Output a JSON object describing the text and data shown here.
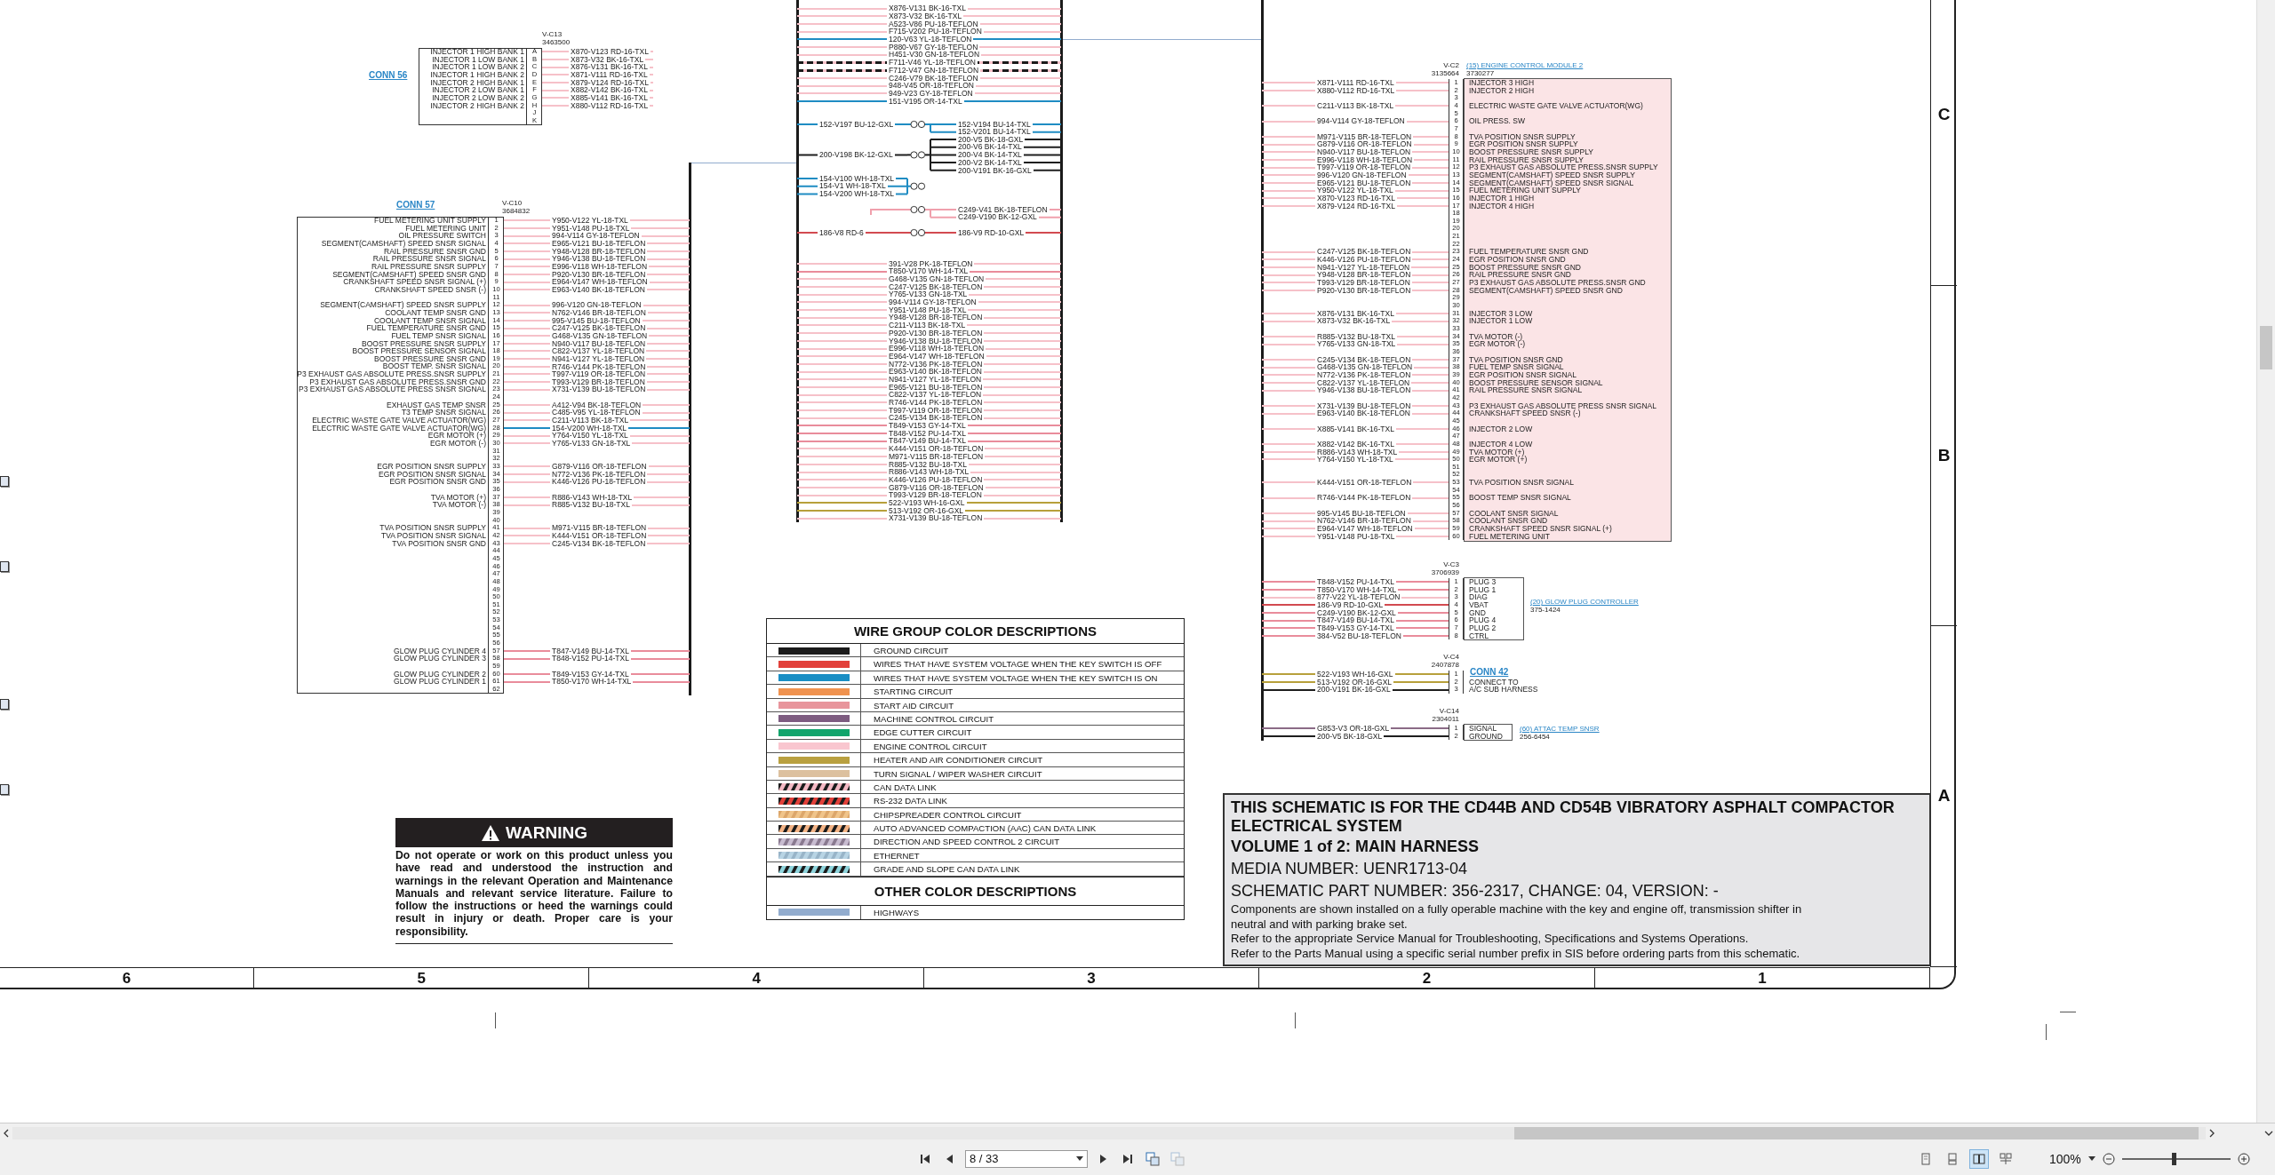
{
  "conn_56": {
    "title": "CONN 56",
    "header": "V-C13",
    "part": "3463500",
    "pins": [
      {
        "pin": "A",
        "label": "INJECTOR 1 HIGH BANK 1",
        "wire": "X870-V123 RD-16-TXL",
        "color": "#f6c1c9"
      },
      {
        "pin": "B",
        "label": "INJECTOR 1 LOW BANK 1",
        "wire": "X873-V32 BK-16-TXL",
        "color": "#f6c1c9"
      },
      {
        "pin": "C",
        "label": "INJECTOR 1 LOW BANK 2",
        "wire": "X876-V131 BK-16-TXL",
        "color": "#f6c1c9"
      },
      {
        "pin": "D",
        "label": "INJECTOR 1 HIGH BANK 2",
        "wire": "X871-V111 RD-16-TXL",
        "color": "#f6c1c9"
      },
      {
        "pin": "E",
        "label": "INJECTOR 2 HIGH BANK 1",
        "wire": "X879-V124 RD-16-TXL",
        "color": "#f6c1c9"
      },
      {
        "pin": "F",
        "label": "INJECTOR 2 LOW BANK 1",
        "wire": "X882-V142 BK-16-TXL",
        "color": "#f6c1c9"
      },
      {
        "pin": "G",
        "label": "INJECTOR 2 LOW BANK 2",
        "wire": "X885-V141 BK-16-TXL",
        "color": "#f6c1c9"
      },
      {
        "pin": "H",
        "label": "INJECTOR 2 HIGH BANK 2",
        "wire": "X880-V112 RD-16-TXL",
        "color": "#f6c1c9"
      },
      {
        "pin": "J"
      },
      {
        "pin": "K"
      }
    ]
  },
  "conn_57": {
    "title": "CONN 57",
    "header": "V-C10",
    "part": "3684832",
    "pins": [
      {
        "pin": "1",
        "label": "FUEL METERING UNIT SUPPLY",
        "wire": "Y950-V122 YL-18-TXL",
        "color": "#f6c1c9"
      },
      {
        "pin": "2",
        "label": "FUEL METERING UNIT",
        "wire": "Y951-V148 PU-18-TXL",
        "color": "#f6c1c9"
      },
      {
        "pin": "3",
        "label": "OIL PRESSURE SWITCH",
        "wire": "994-V114 GY-18-TEFLON",
        "color": "#f6c1c9"
      },
      {
        "pin": "4",
        "label": "SEGMENT(CAMSHAFT) SPEED SNSR SIGNAL",
        "wire": "E965-V121 BU-18-TEFLON",
        "color": "#f6c1c9"
      },
      {
        "pin": "5",
        "label": "RAIL PRESSURE SNSR GND",
        "wire": "Y948-V128 BR-18-TEFLON",
        "color": "#f6c1c9"
      },
      {
        "pin": "6",
        "label": "RAIL PRESSURE SNSR SIGNAL",
        "wire": "Y946-V138 BU-18-TEFLON",
        "color": "#f6c1c9"
      },
      {
        "pin": "7",
        "label": "RAIL PRESSURE SNSR SUPPLY",
        "wire": "E996-V118 WH-18-TEFLON",
        "color": "#f6c1c9"
      },
      {
        "pin": "8",
        "label": "SEGMENT(CAMSHAFT) SPEED SNSR GND",
        "wire": "P920-V130 BR-18-TEFLON",
        "color": "#f6c1c9"
      },
      {
        "pin": "9",
        "label": "CRANKSHAFT SPEED SNSR SIGNAL (+)",
        "wire": "E964-V147 WH-18-TEFLON",
        "color": "#f6c1c9"
      },
      {
        "pin": "10",
        "label": "CRANKSHAFT SPEED SNSR (-)",
        "wire": "E963-V140 BK-18-TEFLON",
        "color": "#f6c1c9"
      },
      {
        "pin": "11"
      },
      {
        "pin": "12",
        "label": "SEGMENT(CAMSHAFT) SPEED SNSR SUPPLY",
        "wire": "996-V120 GN-18-TEFLON",
        "color": "#f6c1c9"
      },
      {
        "pin": "13",
        "label": "COOLANT TEMP SNSR GND",
        "wire": "N762-V146 BR-18-TEFLON",
        "color": "#f6c1c9"
      },
      {
        "pin": "14",
        "label": "COOLANT TEMP SNSR SIGNAL",
        "wire": "995-V145 BU-18-TEFLON",
        "color": "#f6c1c9"
      },
      {
        "pin": "15",
        "label": "FUEL TEMPERATURE SNSR GND",
        "wire": "C247-V125 BK-18-TEFLON",
        "color": "#f6c1c9"
      },
      {
        "pin": "16",
        "label": "FUEL TEMP SNSR SIGNAL",
        "wire": "G468-V135 GN-18-TEFLON",
        "color": "#f6c1c9"
      },
      {
        "pin": "17",
        "label": "BOOST PRESSURE SNSR SUPPLY",
        "wire": "N940-V117 BU-18-TEFLON",
        "color": "#f6c1c9"
      },
      {
        "pin": "18",
        "label": "BOOST PRESSURE SENSOR SIGNAL",
        "wire": "C822-V137 YL-18-TEFLON",
        "color": "#f6c1c9"
      },
      {
        "pin": "19",
        "label": "BOOST PRESSURE SNSR GND",
        "wire": "N941-V127 YL-18-TEFLON",
        "color": "#f6c1c9"
      },
      {
        "pin": "20",
        "label": "BOOST TEMP. SNSR SIGNAL",
        "wire": "R746-V144 PK-18-TEFLON",
        "color": "#f6c1c9"
      },
      {
        "pin": "21",
        "label": "P3 EXHAUST GAS ABSOLUTE PRESS.SNSR SUPPLY",
        "wire": "T997-V119 OR-18-TEFLON",
        "color": "#f6c1c9"
      },
      {
        "pin": "22",
        "label": "P3 EXHAUST GAS ABSOLUTE PRESS.SNSR GND",
        "wire": "T993-V129 BR-18-TEFLON",
        "color": "#f6c1c9"
      },
      {
        "pin": "23",
        "label": "P3 EXHAUST GAS ABSOLUTE PRESS SNSR SIGNAL",
        "wire": "X731-V139 BU-18-TEFLON",
        "color": "#f6c1c9"
      },
      {
        "pin": "24"
      },
      {
        "pin": "25",
        "label": "EXHAUST GAS TEMP SNSR",
        "wire": "A412-V94 BK-18-TEFLON",
        "color": "#f6c1c9"
      },
      {
        "pin": "26",
        "label": "T3 TEMP SNSR SIGNAL",
        "wire": "C485-V95 YL-18-TEFLON",
        "color": "#f6c1c9"
      },
      {
        "pin": "27",
        "label": "ELECTRIC WASTE GATE VALVE ACTUATOR(WG)",
        "wire": "C211-V113 BK-18-TXL",
        "color": "#f6c1c9"
      },
      {
        "pin": "28",
        "label": "ELECTRIC WASTE GATE VALVE ACTUATOR(WG)",
        "wire": "154-V200 WH-18-TXL",
        "color": "#1f8cc3"
      },
      {
        "pin": "29",
        "label": "EGR MOTOR (+)",
        "wire": "Y764-V150 YL-18-TXL",
        "color": "#f6c1c9"
      },
      {
        "pin": "30",
        "label": "EGR MOTOR (-)",
        "wire": "Y765-V133 GN-18-TXL",
        "color": "#f6c1c9"
      },
      {
        "pin": "31"
      },
      {
        "pin": "32"
      },
      {
        "pin": "33",
        "label": "EGR POSITION SNSR SUPPLY",
        "wire": "G879-V116 OR-18-TEFLON",
        "color": "#f6c1c9"
      },
      {
        "pin": "34",
        "label": "EGR POSITION SNSR SIGNAL",
        "wire": "N772-V136 PK-18-TEFLON",
        "color": "#f6c1c9"
      },
      {
        "pin": "35",
        "label": "EGR POSITION SNSR GND",
        "wire": "K446-V126 PU-18-TEFLON",
        "color": "#f6c1c9"
      },
      {
        "pin": "36"
      },
      {
        "pin": "37",
        "label": "TVA MOTOR (+)",
        "wire": "R886-V143 WH-18-TXL",
        "color": "#f6c1c9"
      },
      {
        "pin": "38",
        "label": "TVA MOTOR (-)",
        "wire": "R885-V132 BU-18-TXL",
        "color": "#f6c1c9"
      },
      {
        "pin": "39"
      },
      {
        "pin": "40"
      },
      {
        "pin": "41",
        "label": "TVA POSITION SNSR SUPPLY",
        "wire": "M971-V115 BR-18-TEFLON",
        "color": "#f6c1c9"
      },
      {
        "pin": "42",
        "label": "TVA POSITION SNSR SIGNAL",
        "wire": "K444-V151 OR-18-TEFLON",
        "color": "#f6c1c9"
      },
      {
        "pin": "43",
        "label": "TVA POSITION SNSR GND",
        "wire": "C245-V134 BK-18-TEFLON",
        "color": "#f6c1c9"
      },
      {
        "pin": "44"
      },
      {
        "pin": "45"
      },
      {
        "pin": "46"
      },
      {
        "pin": "47"
      },
      {
        "pin": "48"
      },
      {
        "pin": "49"
      },
      {
        "pin": "50"
      },
      {
        "pin": "51"
      },
      {
        "pin": "52"
      },
      {
        "pin": "53"
      },
      {
        "pin": "54"
      },
      {
        "pin": "55"
      },
      {
        "pin": "56"
      },
      {
        "pin": "57",
        "label": "GLOW PLUG CYLINDER 4",
        "wire": "T847-V149 BU-14-TXL",
        "color": "#e98c9b"
      },
      {
        "pin": "58",
        "label": "GLOW PLUG CYLINDER 3",
        "wire": "T848-V152 PU-14-TXL",
        "color": "#e98c9b"
      },
      {
        "pin": "59"
      },
      {
        "pin": "60",
        "label": "GLOW PLUG CYLINDER 2",
        "wire": "T849-V153 GY-14-TXL",
        "color": "#e98c9b"
      },
      {
        "pin": "61",
        "label": "GLOW PLUG CYLINDER 1",
        "wire": "T850-V170 WH-14-TXL",
        "color": "#e98c9b"
      },
      {
        "pin": "62"
      }
    ]
  },
  "middle_harness": {
    "upper_wires": [
      {
        "wire": "X876-V131 BK-16-TXL",
        "color": "#f6c1c9",
        "dashed": false
      },
      {
        "wire": "X873-V32 BK-16-TXL",
        "color": "#f6c1c9",
        "dashed": false
      },
      {
        "wire": "A523-V86 PU-18-TEFLON",
        "color": "#f6c1c9",
        "dashed": false
      },
      {
        "wire": "F715-V202 PU-18-TEFLON",
        "color": "#f6c1c9",
        "dashed": false
      },
      {
        "wire": "120-V63 YL-18-TEFLON",
        "color": "#1f8cc3",
        "dashed": false
      },
      {
        "wire": "P880-V67 GY-18-TEFLON",
        "color": "#f6c1c9",
        "dashed": false
      },
      {
        "wire": "H451-V30 GN-18-TEFLON",
        "color": "#f6c1c9",
        "dashed": false
      },
      {
        "wire": "F711-V46 YL-18-TEFLON",
        "color": "#f6c1c9",
        "dashed": true
      },
      {
        "wire": "F712-V47 GN-18-TEFLON",
        "color": "#f6c1c9",
        "dashed": true
      },
      {
        "wire": "C246-V79 BK-18-TEFLON",
        "color": "#f6c1c9",
        "dashed": false
      },
      {
        "wire": "948-V45 OR-18-TEFLON",
        "color": "#f6c1c9",
        "dashed": false
      },
      {
        "wire": "949-V23 GY-18-TEFLON",
        "color": "#f6c1c9",
        "dashed": false
      },
      {
        "wire": "151-V195 OR-14-TXL",
        "color": "#1f8cc3",
        "dashed": false
      }
    ],
    "splices": [
      {
        "color": "#1f8cc3",
        "left": [
          "152-V197 BU-12-GXL"
        ],
        "right": [
          "152-V194 BU-14-TXL",
          "152-V201 BU-14-TXL"
        ]
      },
      {
        "color": "#1e1e1e",
        "left": [
          "200-V198 BK-12-GXL"
        ],
        "right": [
          "200-V5 BK-18-GXL",
          "200-V6 BK-14-TXL",
          "200-V4 BK-14-TXL",
          "200-V2 BK-14-TXL",
          "200-V191 BK-16-GXL"
        ]
      },
      {
        "color": "#1f8cc3",
        "left": [
          "154-V100 WH-18-TXL",
          "154-V1 WH-18-TXL",
          "154-V200 WH-18-TXL"
        ]
      },
      {
        "color": "#f0a0ac",
        "right": [
          "C249-V41 BK-18-TEFLON",
          "C249-V190 BK-12-GXL"
        ]
      },
      {
        "color": "#d24a50",
        "left": [
          "186-V8 RD-6"
        ],
        "right": [
          "186-V9 RD-10-GXL"
        ]
      }
    ],
    "lower_wires": [
      {
        "wire": "391-V28 PK-18-TEFLON",
        "color": "#f6c1c9",
        "dashed": false
      },
      {
        "wire": "T850-V170 WH-14-TXL",
        "color": "#e98c9b",
        "dashed": false
      },
      {
        "wire": "G468-V135 GN-18-TEFLON",
        "color": "#f6c1c9",
        "dashed": false
      },
      {
        "wire": "C247-V125 BK-18-TEFLON",
        "color": "#f6c1c9",
        "dashed": false
      },
      {
        "wire": "Y765-V133 GN-18-TXL",
        "color": "#f6c1c9",
        "dashed": false
      },
      {
        "wire": "994-V114 GY-18-TEFLON",
        "color": "#f6c1c9",
        "dashed": false
      },
      {
        "wire": "Y951-V148 PU-18-TXL",
        "color": "#f6c1c9",
        "dashed": false
      },
      {
        "wire": "Y948-V128 BR-18-TEFLON",
        "color": "#f6c1c9",
        "dashed": false
      },
      {
        "wire": "C211-V113 BK-18-TXL",
        "color": "#f6c1c9",
        "dashed": false
      },
      {
        "wire": "P920-V130 BR-18-TEFLON",
        "color": "#f6c1c9",
        "dashed": false
      },
      {
        "wire": "Y946-V138 BU-18-TEFLON",
        "color": "#f6c1c9",
        "dashed": false
      },
      {
        "wire": "E996-V118 WH-18-TEFLON",
        "color": "#f6c1c9",
        "dashed": false
      },
      {
        "wire": "E964-V147 WH-18-TEFLON",
        "color": "#f6c1c9",
        "dashed": false
      },
      {
        "wire": "N772-V136 PK-18-TEFLON",
        "color": "#f6c1c9",
        "dashed": false
      },
      {
        "wire": "E963-V140 BK-18-TEFLON",
        "color": "#f6c1c9",
        "dashed": false
      },
      {
        "wire": "N941-V127 YL-18-TEFLON",
        "color": "#f6c1c9",
        "dashed": false
      },
      {
        "wire": "E965-V121 BU-18-TEFLON",
        "color": "#f6c1c9",
        "dashed": false
      },
      {
        "wire": "C822-V137 YL-18-TEFLON",
        "color": "#f6c1c9",
        "dashed": false
      },
      {
        "wire": "R746-V144 PK-18-TEFLON",
        "color": "#f6c1c9",
        "dashed": false
      },
      {
        "wire": "T997-V119 OR-18-TEFLON",
        "color": "#f6c1c9",
        "dashed": false
      },
      {
        "wire": "C245-V134 BK-18-TEFLON",
        "color": "#f6c1c9",
        "dashed": false
      },
      {
        "wire": "T849-V153 GY-14-TXL",
        "color": "#e98c9b",
        "dashed": false
      },
      {
        "wire": "T848-V152 PU-14-TXL",
        "color": "#e98c9b",
        "dashed": false
      },
      {
        "wire": "T847-V149 BU-14-TXL",
        "color": "#e98c9b",
        "dashed": false
      },
      {
        "wire": "K444-V151 OR-18-TEFLON",
        "color": "#f6c1c9",
        "dashed": false
      },
      {
        "wire": "M971-V115 BR-18-TEFLON",
        "color": "#f6c1c9",
        "dashed": false
      },
      {
        "wire": "R885-V132 BU-18-TXL",
        "color": "#f6c1c9",
        "dashed": false
      },
      {
        "wire": "R886-V143 WH-18-TXL",
        "color": "#f6c1c9",
        "dashed": false
      },
      {
        "wire": "K446-V126 PU-18-TEFLON",
        "color": "#f6c1c9",
        "dashed": false
      },
      {
        "wire": "G879-V116 OR-18-TEFLON",
        "color": "#f6c1c9",
        "dashed": false
      },
      {
        "wire": "T993-V129 BR-18-TEFLON",
        "color": "#f6c1c9",
        "dashed": false
      },
      {
        "wire": "522-V193 WH-16-GXL",
        "color": "#b7a03b",
        "dashed": false
      },
      {
        "wire": "513-V192 OR-16-GXL",
        "color": "#b7a03b",
        "dashed": false
      },
      {
        "wire": "X731-V139 BU-18-TEFLON",
        "color": "#f6c1c9",
        "dashed": false
      }
    ]
  },
  "ecm": {
    "header": "V-C2",
    "part": "3135664",
    "module": "(15) ENGINE CONTROL MODULE 2",
    "module_part": "3730277",
    "pins": [
      {
        "pin": "1",
        "wire": "X871-V111 RD-16-TXL",
        "color": "#f6c1c9",
        "label": "INJECTOR 3 HIGH"
      },
      {
        "pin": "2",
        "wire": "X880-V112 RD-16-TXL",
        "color": "#f6c1c9",
        "label": "INJECTOR 2 HIGH"
      },
      {
        "pin": "3"
      },
      {
        "pin": "4",
        "wire": "C211-V113 BK-18-TXL",
        "color": "#f6c1c9",
        "label": "ELECTRIC WASTE GATE VALVE ACTUATOR(WG)"
      },
      {
        "pin": "5"
      },
      {
        "pin": "6",
        "wire": "994-V114 GY-18-TEFLON",
        "color": "#f6c1c9",
        "label": "OIL PRESS. SW"
      },
      {
        "pin": "7"
      },
      {
        "pin": "8",
        "wire": "M971-V115 BR-18-TEFLON",
        "color": "#f6c1c9",
        "label": "TVA POSITION SNSR SUPPLY"
      },
      {
        "pin": "9",
        "wire": "G879-V116 OR-18-TEFLON",
        "color": "#f6c1c9",
        "label": "EGR POSITION SNSR SUPPLY"
      },
      {
        "pin": "10",
        "wire": "N940-V117 BU-18-TEFLON",
        "color": "#f6c1c9",
        "label": "BOOST PRESSURE SNSR SUPPLY"
      },
      {
        "pin": "11",
        "wire": "E996-V118 WH-18-TEFLON",
        "color": "#f6c1c9",
        "label": "RAIL PRESSURE SNSR SUPPLY"
      },
      {
        "pin": "12",
        "wire": "T997-V119 OR-18-TEFLON",
        "color": "#f6c1c9",
        "label": "P3 EXHAUST GAS ABSOLUTE PRESS.SNSR SUPPLY"
      },
      {
        "pin": "13",
        "wire": "996-V120 GN-18-TEFLON",
        "color": "#f6c1c9",
        "label": "SEGMENT(CAMSHAFT) SPEED SNSR SUPPLY"
      },
      {
        "pin": "14",
        "wire": "E965-V121 BU-18-TEFLON",
        "color": "#f6c1c9",
        "label": "SEGMENT(CAMSHAFT) SPEED SNSR SIGNAL"
      },
      {
        "pin": "15",
        "wire": "Y950-V122 YL-18-TXL",
        "color": "#f6c1c9",
        "label": "FUEL METERING UNIT SUPPLY"
      },
      {
        "pin": "16",
        "wire": "X870-V123 RD-16-TXL",
        "color": "#f6c1c9",
        "label": "INJECTOR 1 HIGH"
      },
      {
        "pin": "17",
        "wire": "X879-V124 RD-16-TXL",
        "color": "#f6c1c9",
        "label": "INJECTOR 4 HIGH"
      },
      {
        "pin": "18"
      },
      {
        "pin": "19"
      },
      {
        "pin": "20"
      },
      {
        "pin": "21"
      },
      {
        "pin": "22"
      },
      {
        "pin": "23",
        "wire": "C247-V125 BK-18-TEFLON",
        "color": "#f6c1c9",
        "label": "FUEL TEMPERATURE SNSR GND"
      },
      {
        "pin": "24",
        "wire": "K446-V126 PU-18-TEFLON",
        "color": "#f6c1c9",
        "label": "EGR POSITION SNSR GND"
      },
      {
        "pin": "25",
        "wire": "N941-V127 YL-18-TEFLON",
        "color": "#f6c1c9",
        "label": "BOOST PRESSURE SNSR GND"
      },
      {
        "pin": "26",
        "wire": "Y948-V128 BR-18-TEFLON",
        "color": "#f6c1c9",
        "label": "RAIL PRESSURE SNSR GND"
      },
      {
        "pin": "27",
        "wire": "T993-V129 BR-18-TEFLON",
        "color": "#f6c1c9",
        "label": "P3 EXHAUST GAS ABSOLUTE PRESS.SNSR GND"
      },
      {
        "pin": "28",
        "wire": "P920-V130 BR-18-TEFLON",
        "color": "#f6c1c9",
        "label": "SEGMENT(CAMSHAFT) SPEED SNSR GND"
      },
      {
        "pin": "29"
      },
      {
        "pin": "30"
      },
      {
        "pin": "31",
        "wire": "X876-V131 BK-16-TXL",
        "color": "#f6c1c9",
        "label": "INJECTOR 3 LOW"
      },
      {
        "pin": "32",
        "wire": "X873-V32 BK-16-TXL",
        "color": "#f6c1c9",
        "label": "INJECTOR 1 LOW"
      },
      {
        "pin": "33"
      },
      {
        "pin": "34",
        "wire": "R885-V132 BU-18-TXL",
        "color": "#f6c1c9",
        "label": "TVA MOTOR (-)"
      },
      {
        "pin": "35",
        "wire": "Y765-V133 GN-18-TXL",
        "color": "#f6c1c9",
        "label": "EGR MOTOR (-)"
      },
      {
        "pin": "36"
      },
      {
        "pin": "37",
        "wire": "C245-V134 BK-18-TEFLON",
        "color": "#f6c1c9",
        "label": "TVA POSITION SNSR GND"
      },
      {
        "pin": "38",
        "wire": "G468-V135 GN-18-TEFLON",
        "color": "#f6c1c9",
        "label": "FUEL TEMP SNSR SIGNAL"
      },
      {
        "pin": "39",
        "wire": "N772-V136 PK-18-TEFLON",
        "color": "#f6c1c9",
        "label": "EGR POSITION SNSR SIGNAL"
      },
      {
        "pin": "40",
        "wire": "C822-V137 YL-18-TEFLON",
        "color": "#f6c1c9",
        "label": "BOOST PRESSURE SENSOR SIGNAL"
      },
      {
        "pin": "41",
        "wire": "Y946-V138 BU-18-TEFLON",
        "color": "#f6c1c9",
        "label": "RAIL PRESSURE SNSR SIGNAL"
      },
      {
        "pin": "42"
      },
      {
        "pin": "43",
        "wire": "X731-V139 BU-18-TEFLON",
        "color": "#f6c1c9",
        "label": "P3 EXHAUST GAS ABSOLUTE PRESS SNSR SIGNAL"
      },
      {
        "pin": "44",
        "wire": "E963-V140 BK-18-TEFLON",
        "color": "#f6c1c9",
        "label": "CRANKSHAFT SPEED SNSR (-)"
      },
      {
        "pin": "45"
      },
      {
        "pin": "46",
        "wire": "X885-V141 BK-16-TXL",
        "color": "#f6c1c9",
        "label": "INJECTOR 2 LOW"
      },
      {
        "pin": "47"
      },
      {
        "pin": "48",
        "wire": "X882-V142 BK-16-TXL",
        "color": "#f6c1c9",
        "label": "INJECTOR 4 LOW"
      },
      {
        "pin": "49",
        "wire": "R886-V143 WH-18-TXL",
        "color": "#f6c1c9",
        "label": "TVA MOTOR (+)"
      },
      {
        "pin": "50",
        "wire": "Y764-V150 YL-18-TXL",
        "color": "#f6c1c9",
        "label": "EGR MOTOR (+)"
      },
      {
        "pin": "51"
      },
      {
        "pin": "52"
      },
      {
        "pin": "53",
        "wire": "K444-V151 OR-18-TEFLON",
        "color": "#f6c1c9",
        "label": "TVA POSITION SNSR SIGNAL"
      },
      {
        "pin": "54"
      },
      {
        "pin": "55",
        "wire": "R746-V144 PK-18-TEFLON",
        "color": "#f6c1c9",
        "label": "BOOST TEMP SNSR SIGNAL"
      },
      {
        "pin": "56"
      },
      {
        "pin": "57",
        "wire": "995-V145 BU-18-TEFLON",
        "color": "#f6c1c9",
        "label": "COOLANT SNSR SIGNAL"
      },
      {
        "pin": "58",
        "wire": "N762-V146 BR-18-TEFLON",
        "color": "#f6c1c9",
        "label": "COOLANT SNSR GND"
      },
      {
        "pin": "59",
        "wire": "E964-V147 WH-18-TEFLON",
        "color": "#f6c1c9",
        "label": "CRANKSHAFT SPEED SNSR SIGNAL (+)"
      },
      {
        "pin": "60",
        "wire": "Y951-V148 PU-18-TXL",
        "color": "#f6c1c9",
        "label": "FUEL METERING UNIT"
      }
    ]
  },
  "glow_plug_controller": {
    "header": "V-C3",
    "part": "3706939",
    "module": "(20) GLOW PLUG CONTROLLER",
    "module_part": "375-1424",
    "pins": [
      {
        "pin": "1",
        "wire": "T848-V152 PU-14-TXL",
        "color": "#e98c9b",
        "label": "PLUG 3"
      },
      {
        "pin": "2",
        "wire": "T850-V170 WH-14-TXL",
        "color": "#e98c9b",
        "label": "PLUG 1"
      },
      {
        "pin": "3",
        "wire": "877-V22 YL-18-TEFLON",
        "color": "#f6c1c9",
        "label": "DIAG"
      },
      {
        "pin": "4",
        "wire": "186-V9 RD-10-GXL",
        "color": "#d24a50",
        "label": "VBAT"
      },
      {
        "pin": "5",
        "wire": "C249-V190 BK-12-GXL",
        "color": "#e98c9b",
        "label": "GND"
      },
      {
        "pin": "6",
        "wire": "T847-V149 BU-14-TXL",
        "color": "#e98c9b",
        "label": "PLUG 4"
      },
      {
        "pin": "7",
        "wire": "T849-V153 GY-14-TXL",
        "color": "#e98c9b",
        "label": "PLUG 2"
      },
      {
        "pin": "8",
        "wire": "384-V52 BU-18-TEFLON",
        "color": "#e98c9b",
        "label": "CTRL"
      }
    ]
  },
  "conn_42": {
    "header": "V-C4",
    "part": "2407878",
    "title": "CONN 42",
    "pins": [
      {
        "pin": "1",
        "wire": "522-V193 WH-16-GXL",
        "color": "#b7a03b"
      },
      {
        "pin": "2",
        "wire": "513-V192 OR-16-GXL",
        "color": "#b7a03b",
        "label": "CONNECT TO"
      },
      {
        "pin": "3",
        "wire": "200-V191 BK-16-GXL",
        "color": "#1e1e1e",
        "label": "A/C SUB HARNESS"
      }
    ]
  },
  "attac_temp_sensor": {
    "header": "V-C14",
    "part": "2304011",
    "module": "(60) ATTAC TEMP SNSR",
    "module_part": "256-6454",
    "pins": [
      {
        "pin": "1",
        "wire": "G853-V3 OR-18-GXL",
        "color": "#8b6b86",
        "label": "SIGNAL"
      },
      {
        "pin": "2",
        "wire": "200-V5 BK-18-GXL",
        "color": "#1e1e1e",
        "label": "GROUND"
      }
    ]
  },
  "legend": {
    "title": "WIRE GROUP COLOR DESCRIPTIONS",
    "items": [
      {
        "label": "GROUND CIRCUIT",
        "kind": "solid",
        "color": "#1c1c1c"
      },
      {
        "label": "WIRES THAT HAVE SYSTEM VOLTAGE WHEN THE KEY SWITCH IS OFF",
        "kind": "solid",
        "color": "#e2403a"
      },
      {
        "label": "WIRES THAT HAVE SYSTEM VOLTAGE WHEN THE KEY SWITCH IS ON",
        "kind": "solid",
        "color": "#1a8ec4"
      },
      {
        "label": "STARTING CIRCUIT",
        "kind": "solid",
        "color": "#f0924e"
      },
      {
        "label": "START AID CIRCUIT",
        "kind": "solid",
        "color": "#e8959c"
      },
      {
        "label": "MACHINE CONTROL CIRCUIT",
        "kind": "solid",
        "color": "#7d5c80"
      },
      {
        "label": "EDGE CUTTER CIRCUIT",
        "kind": "solid",
        "color": "#12a46c"
      },
      {
        "label": "ENGINE CONTROL CIRCUIT",
        "kind": "solid",
        "color": "#f9c6cf"
      },
      {
        "label": "HEATER AND AIR CONDITIONER CIRCUIT",
        "kind": "solid",
        "color": "#b9a040"
      },
      {
        "label": "TURN SIGNAL / WIPER WASHER CIRCUIT",
        "kind": "solid",
        "color": "#dcc09e"
      },
      {
        "label": "CAN DATA LINK",
        "kind": "striped",
        "color": "#f4b9c4",
        "stripes": {
          "color": "#1c1c1c"
        }
      },
      {
        "label": "RS-232 DATA LINK",
        "kind": "striped",
        "color": "#e2403a",
        "stripes": {
          "color": "#1c1c1c"
        }
      },
      {
        "label": "CHIPSPREADER CONTROL CIRCUIT",
        "kind": "striped",
        "color": "#f0c48a",
        "stripes": {
          "color": "#dca66a"
        }
      },
      {
        "label": "AUTO ADVANCED COMPACTION (AAC) CAN DATA LINK",
        "kind": "striped",
        "color": "#f4b486",
        "stripes": {
          "color": "#1c1c1c"
        }
      },
      {
        "label": "DIRECTION AND SPEED CONTROL 2 CIRCUIT",
        "kind": "striped",
        "color": "#c8bcd0",
        "stripes": {
          "color": "#8a7a90"
        }
      },
      {
        "label": "ETHERNET",
        "kind": "striped",
        "color": "#b8d4e4",
        "stripes": {
          "color": "#98b4c8"
        }
      },
      {
        "label": "GRADE AND SLOPE CAN DATA LINK",
        "kind": "striped",
        "color": "#8ed4dc",
        "stripes": {
          "color": "#1c1c1c"
        }
      }
    ],
    "other_title": "OTHER COLOR DESCRIPTIONS",
    "other_items": [
      {
        "label": "HIGHWAYS",
        "kind": "solid",
        "color": "#92acce"
      }
    ]
  },
  "warning": {
    "title": "WARNING",
    "text": "Do not operate or work on this product unless you have read and understood the instruction and warnings in the relevant Operation and Maintenance Manuals and relevant service literature. Failure to follow the instructions or heed the warnings could result in injury or death. Proper care is your responsibility."
  },
  "title_block": {
    "headings": [
      "THIS SCHEMATIC IS FOR THE CD44B AND CD54B VIBRATORY ASPHALT COMPACTOR ELECTRICAL SYSTEM",
      "VOLUME 1 of 2: MAIN HARNESS"
    ],
    "media_number": "MEDIA NUMBER: UENR1713-04",
    "part_number": "SCHEMATIC PART NUMBER: 356-2317, CHANGE: 04, VERSION: -",
    "notes": [
      "Components are shown installed on a fully operable machine with the key and engine off, transmission shifter in neutral and with parking brake set.",
      "Refer to the appropriate Service Manual for Troubleshooting, Specifications and Systems Operations.",
      "Refer to the Parts Manual using a specific serial number prefix in SIS before ordering parts from this schematic."
    ]
  },
  "grid": {
    "rows": [
      "C",
      "B",
      "A"
    ],
    "columns": [
      "6",
      "5",
      "4",
      "3",
      "2",
      "1"
    ]
  },
  "toolbar": {
    "page_field": "8 / 33",
    "zoom": "100%",
    "zoom_slider": {
      "level": 0.48
    },
    "copy_tools": [
      {
        "disabled": false
      },
      {
        "disabled": true
      }
    ],
    "view_modes": [
      {
        "selected": false
      },
      {
        "selected": false
      },
      {
        "selected": true
      },
      {
        "selected": false
      }
    ]
  }
}
